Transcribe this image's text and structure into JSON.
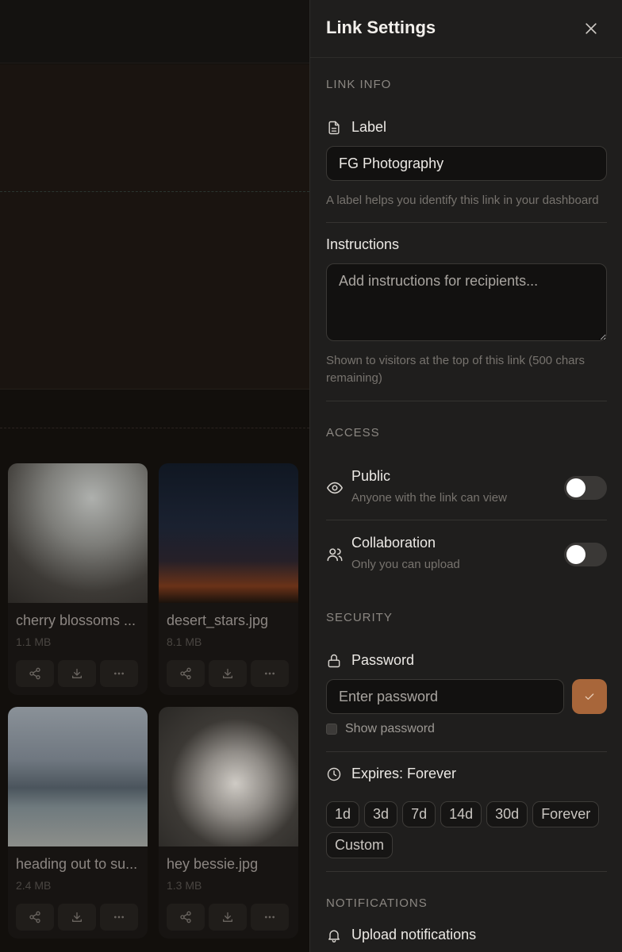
{
  "panel": {
    "title": "Link Settings",
    "sections": {
      "link_info": "LINK INFO",
      "access": "ACCESS",
      "security": "SECURITY",
      "notifications": "NOTIFICATIONS"
    },
    "label_field": {
      "label": "Label",
      "value": "FG Photography",
      "hint": "A label helps you identify this link in your dashboard"
    },
    "instructions_field": {
      "label": "Instructions",
      "placeholder": "Add instructions for recipients...",
      "hint": "Shown to visitors at the top of this link (500 chars remaining)"
    },
    "access": {
      "public": {
        "title": "Public",
        "subtitle": "Anyone with the link can view",
        "enabled": false
      },
      "collaboration": {
        "title": "Collaboration",
        "subtitle": "Only you can upload",
        "enabled": false
      }
    },
    "password": {
      "label": "Password",
      "placeholder": "Enter password",
      "show_label": "Show password"
    },
    "expires": {
      "label": "Expires: Forever",
      "options": [
        "1d",
        "3d",
        "7d",
        "14d",
        "30d",
        "Forever",
        "Custom"
      ]
    },
    "notifications": {
      "upload_label": "Upload notifications"
    },
    "accent_color": "#a8663a"
  },
  "gallery": {
    "files": [
      {
        "name": "cherry blossoms ...",
        "size": "1.1 MB"
      },
      {
        "name": "desert_stars.jpg",
        "size": "8.1 MB"
      },
      {
        "name": "heading out to su...",
        "size": "2.4 MB"
      },
      {
        "name": "hey bessie.jpg",
        "size": "1.3 MB"
      }
    ]
  }
}
